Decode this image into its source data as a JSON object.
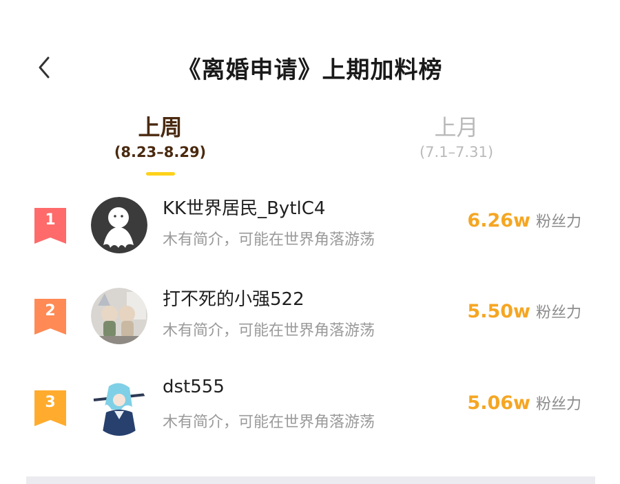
{
  "header": {
    "back_icon": "chevron-left-icon",
    "title": "《离婚申请》上期加料榜"
  },
  "tabs": [
    {
      "label": "上周",
      "range": "(8.23–8.29)",
      "active": true
    },
    {
      "label": "上月",
      "range": "(7.1–7.31)",
      "active": false
    }
  ],
  "colors": {
    "accent": "#ffd21a",
    "score": "#f5a623",
    "rank1": "#ff6a6a",
    "rank2": "#ff8a55",
    "rank3": "#ffac2e"
  },
  "ranking": [
    {
      "rank": "1",
      "name": "KK世界居民_BytlC4",
      "bio": "木有简介，可能在世界角落游荡",
      "score": "6.26w",
      "unit": "粉丝力",
      "avatar": "default-avatar"
    },
    {
      "rank": "2",
      "name": "打不死的小强522",
      "bio": "木有简介，可能在世界角落游荡",
      "score": "5.50w",
      "unit": "粉丝力",
      "avatar": "figurines-photo-avatar"
    },
    {
      "rank": "3",
      "name": "dst555",
      "bio": "木有简介，可能在世界角落游荡",
      "score": "5.06w",
      "unit": "粉丝力",
      "avatar": "anime-character-avatar"
    }
  ]
}
